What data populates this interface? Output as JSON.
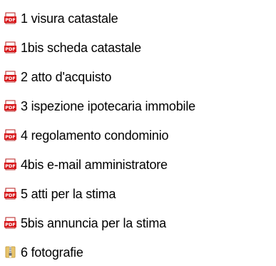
{
  "files": [
    {
      "name": "1 visura catastale",
      "icon": "pdf-file-icon"
    },
    {
      "name": "1bis scheda catastale",
      "icon": "pdf-file-icon"
    },
    {
      "name": "2 atto d'acquisto",
      "icon": "pdf-file-icon"
    },
    {
      "name": "3 ispezione ipotecaria immobile",
      "icon": "pdf-file-icon"
    },
    {
      "name": "4 regolamento condominio",
      "icon": "pdf-file-icon"
    },
    {
      "name": "4bis e-mail amministratore",
      "icon": "pdf-file-icon"
    },
    {
      "name": "5 atti per la stima",
      "icon": "pdf-file-icon"
    },
    {
      "name": "5bis annuncia per la stima",
      "icon": "pdf-file-icon"
    },
    {
      "name": "6 fotografie",
      "icon": "zip-folder-icon"
    }
  ],
  "colors": {
    "pdf_red": "#d7191c",
    "pdf_badge_text": "#ffffff",
    "zip_folder": "#e8c46b",
    "zip_zipper": "#8a8a8a"
  }
}
